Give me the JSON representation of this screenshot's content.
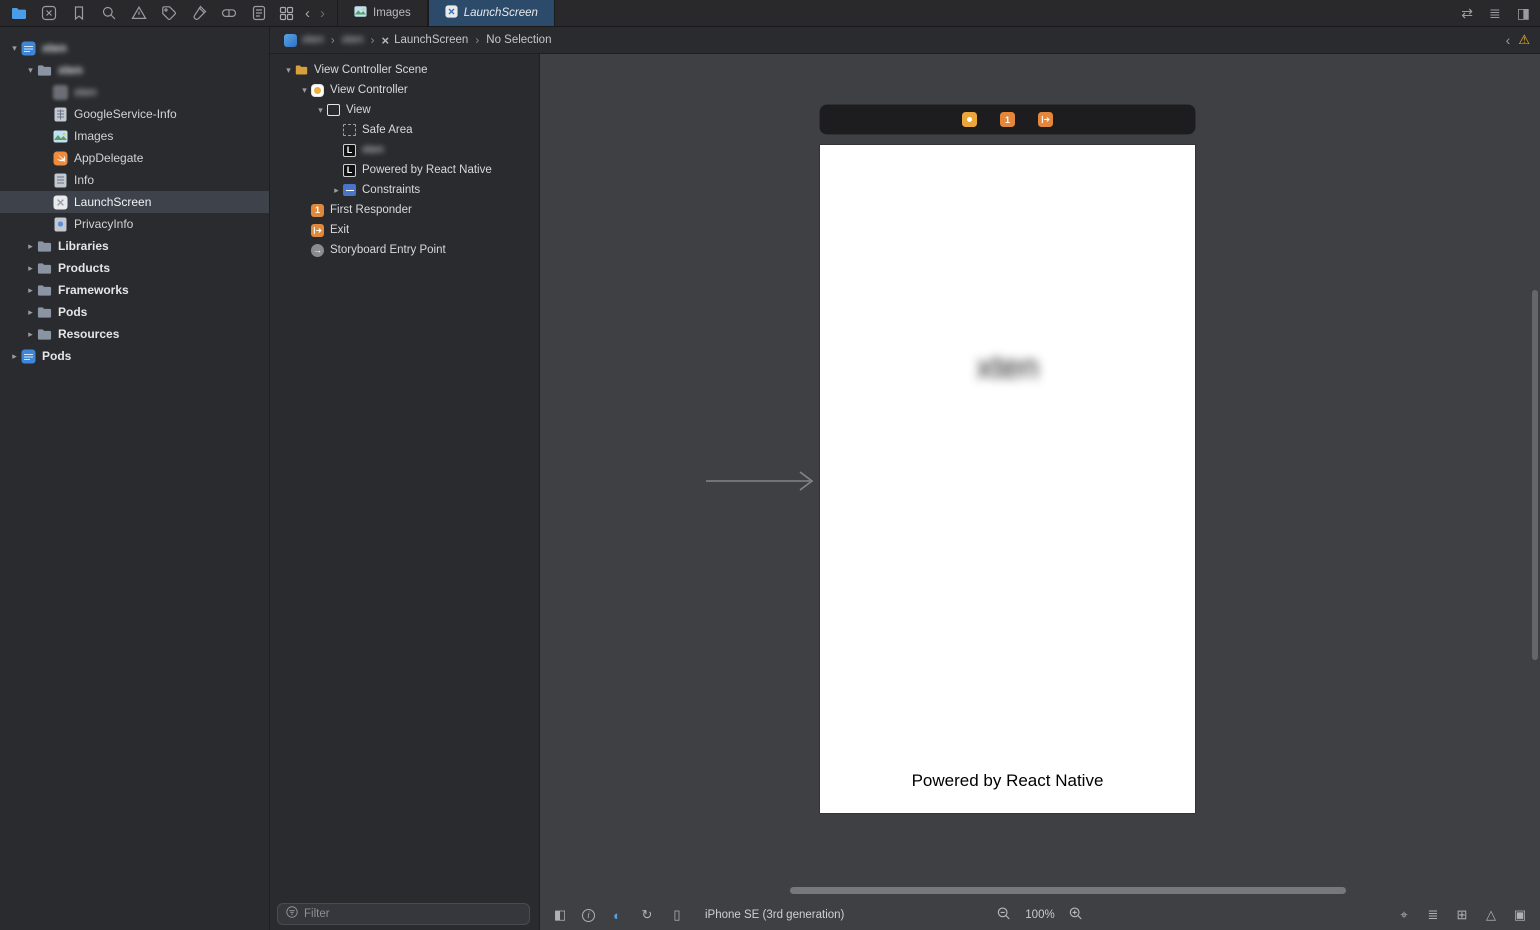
{
  "toolbar": {
    "tab_images": "Images",
    "tab_launchscreen": "LaunchScreen"
  },
  "jumpbar": {
    "project": "xten",
    "group": "xten",
    "file": "LaunchScreen",
    "selection": "No Selection"
  },
  "navigator": {
    "items": [
      {
        "label": "xten"
      },
      {
        "label": "xten"
      },
      {
        "label": "xten"
      },
      {
        "label": "GoogleService-Info"
      },
      {
        "label": "Images"
      },
      {
        "label": "AppDelegate"
      },
      {
        "label": "Info"
      },
      {
        "label": "LaunchScreen"
      },
      {
        "label": "PrivacyInfo"
      },
      {
        "label": "Libraries"
      },
      {
        "label": "Products"
      },
      {
        "label": "Frameworks"
      },
      {
        "label": "Pods"
      },
      {
        "label": "Resources"
      },
      {
        "label": "Pods"
      }
    ]
  },
  "outline": {
    "items": [
      {
        "label": "View Controller Scene"
      },
      {
        "label": "View Controller"
      },
      {
        "label": "View"
      },
      {
        "label": "Safe Area"
      },
      {
        "label": "xten"
      },
      {
        "label": "Powered by React Native"
      },
      {
        "label": "Constraints"
      },
      {
        "label": "First Responder"
      },
      {
        "label": "Exit"
      },
      {
        "label": "Storyboard Entry Point"
      }
    ],
    "filter_placeholder": "Filter"
  },
  "canvas": {
    "launch_title": "xten",
    "powered_by": "Powered by React Native"
  },
  "statusbar": {
    "device": "iPhone SE (3rd generation)",
    "zoom": "100%"
  },
  "icons": {
    "chevron_down": "▾",
    "chevron_right": "▸",
    "crumb_sep": "›",
    "back": "‹",
    "forward": "›",
    "warning": "⚠",
    "swap": "⇄",
    "menu_lines": "≣",
    "left_panel": "◧",
    "right_panel": "◨",
    "appearance": "◐",
    "rotate": "↻",
    "device": "▯",
    "info": "i",
    "update_frames": "⌖",
    "align": "≣",
    "add_constraints": "⊞",
    "resolve": "△",
    "embed": "▣",
    "close_x": "×",
    "label_letter": "L",
    "first_responder_number": "1",
    "entry_arrow": "→"
  },
  "colors": {
    "accent": "#4a9ee8",
    "tab_active": "#2c4a69",
    "orange": "#e0883c",
    "yellow": "#eaa53c",
    "warning": "#f0b429"
  }
}
